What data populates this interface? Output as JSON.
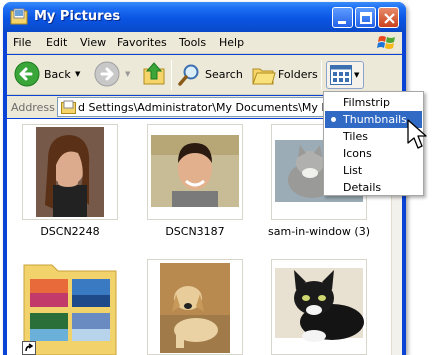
{
  "window": {
    "title": "My Pictures"
  },
  "menubar": {
    "items": [
      "File",
      "Edit",
      "View",
      "Favorites",
      "Tools",
      "Help"
    ]
  },
  "toolbar": {
    "back_label": "Back",
    "search_label": "Search",
    "folders_label": "Folders"
  },
  "addressbar": {
    "label": "Address",
    "value": "d Settings\\Administrator\\My Documents\\My Pictures"
  },
  "views_menu": {
    "items": [
      "Filmstrip",
      "Thumbnails",
      "Tiles",
      "Icons",
      "List",
      "Details"
    ],
    "selected": "Thumbnails"
  },
  "files": [
    {
      "name": "DSCN2248"
    },
    {
      "name": "DSCN3187"
    },
    {
      "name": "sam-in-window (3)"
    }
  ],
  "colors": {
    "titlebar": "#0a55e4",
    "chrome": "#ece9d8",
    "selection": "#316ac5"
  }
}
